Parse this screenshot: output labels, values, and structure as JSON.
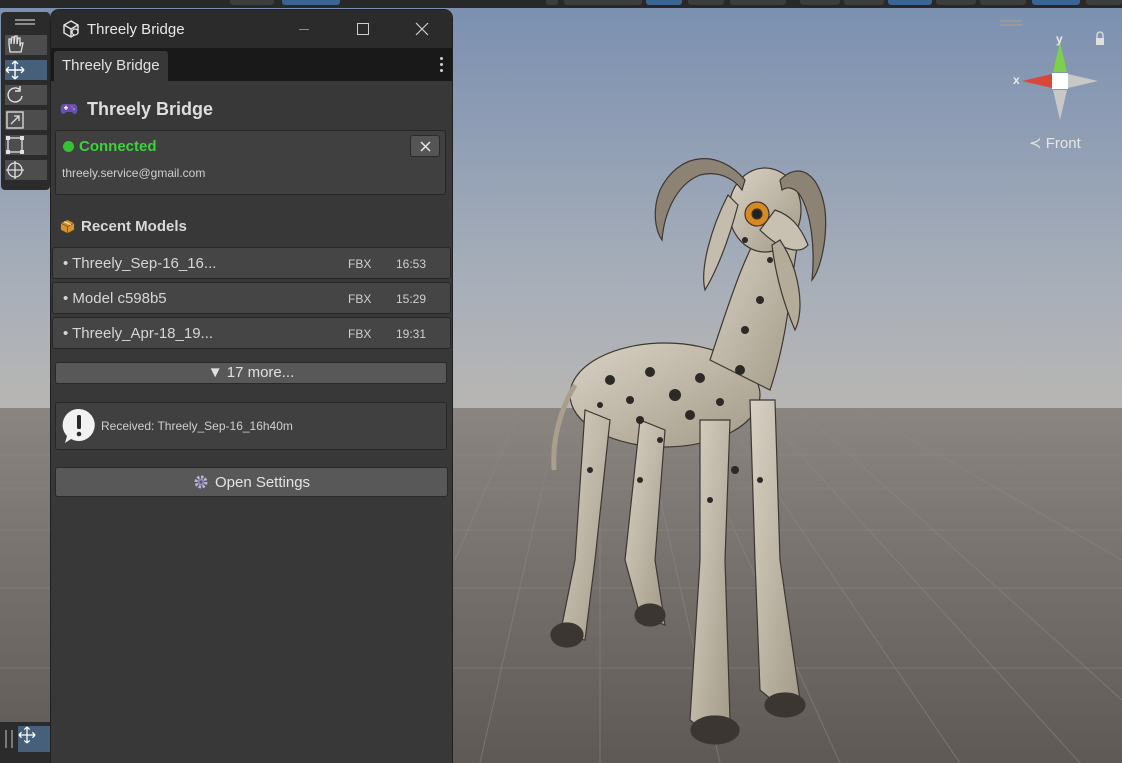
{
  "window": {
    "title": "Threely Bridge",
    "tab_label": "Threely Bridge"
  },
  "panel": {
    "header_title": "Threely Bridge",
    "connection": {
      "status": "Connected",
      "email": "threely.service@gmail.com",
      "status_color": "#3dd23d"
    },
    "recent_models": {
      "label": "Recent Models",
      "items": [
        {
          "name": "• Threely_Sep-16_16...",
          "format": "FBX",
          "time": "16:53"
        },
        {
          "name": "• Model c598b5",
          "format": "FBX",
          "time": "15:29"
        },
        {
          "name": "• Threely_Apr-18_19...",
          "format": "FBX",
          "time": "19:31"
        }
      ],
      "more_label": "▼ 17 more..."
    },
    "notice": {
      "message": "Received: Threely_Sep-16_16h40m",
      "icon": "exclamation-bubble-icon"
    },
    "settings_button_label": "Open Settings"
  },
  "scene": {
    "gizmo": {
      "view_label": "Front",
      "x_label": "x",
      "y_label": "y"
    },
    "tools": [
      "hand-tool-icon",
      "move-tool-icon",
      "rotate-tool-icon",
      "scale-tool-icon",
      "rect-tool-icon",
      "transform-tool-icon"
    ],
    "active_tool": "move-tool-icon"
  },
  "colors": {
    "accent_blue": "#46607c",
    "panel_bg": "#383838",
    "sky_top": "#8aa0be",
    "ground": "#6e6863"
  }
}
